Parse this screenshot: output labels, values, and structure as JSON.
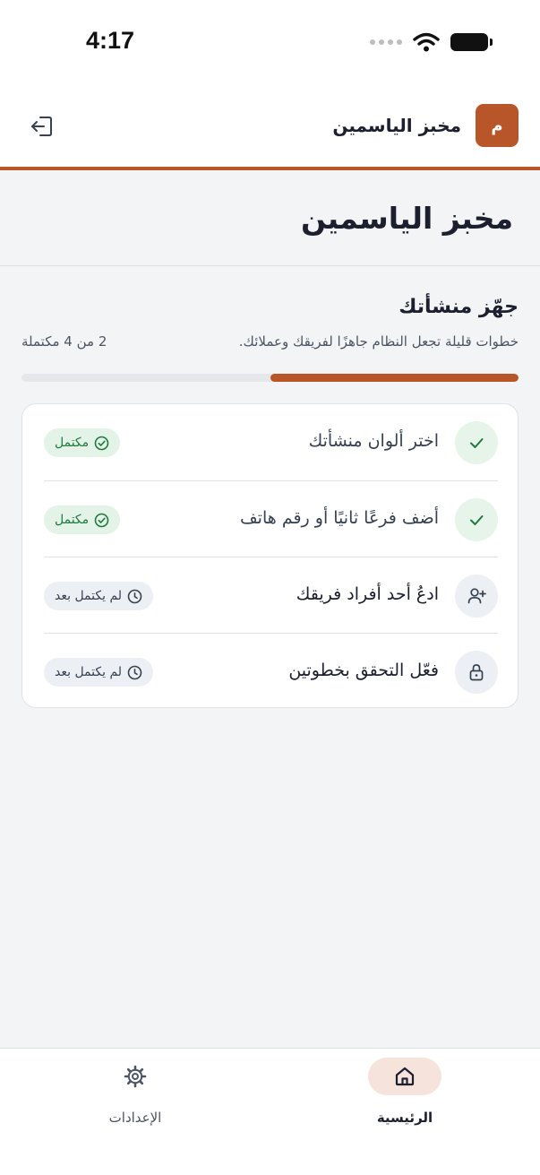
{
  "status_bar": {
    "time": "4:17"
  },
  "header": {
    "avatar_letter": "م",
    "business_name": "مخبز الياسمين"
  },
  "page": {
    "title": "مخبز الياسمين"
  },
  "setup": {
    "title": "جهّز منشأتك",
    "subtitle": "خطوات قليلة تجعل النظام جاهزًا لفريقك وعملائك.",
    "progress_text": "2 من 4 مكتملة",
    "completed": 2,
    "total": 4,
    "progress_fraction": 0.5
  },
  "tasks": [
    {
      "label": "اختر ألوان منشأتك",
      "status": "مكتمل",
      "state": "done",
      "icon": "check-icon"
    },
    {
      "label": "أضف فرعًا ثانيًا أو رقم هاتف",
      "status": "مكتمل",
      "state": "done",
      "icon": "check-icon"
    },
    {
      "label": "ادعُ أحد أفراد فريقك",
      "status": "لم يكتمل بعد",
      "state": "todo",
      "icon": "user-plus-icon"
    },
    {
      "label": "فعّل التحقق بخطوتين",
      "status": "لم يكتمل بعد",
      "state": "todo",
      "icon": "lock-icon"
    }
  ],
  "tabs": [
    {
      "label": "الرئيسية",
      "icon": "home-icon",
      "active": true
    },
    {
      "label": "الإعدادات",
      "icon": "gear-icon",
      "active": false
    }
  ],
  "colors": {
    "accent": "#b8562a",
    "success": "#1f7a3e",
    "success_bg": "#e3f3e7",
    "background": "#f3f4f6"
  }
}
